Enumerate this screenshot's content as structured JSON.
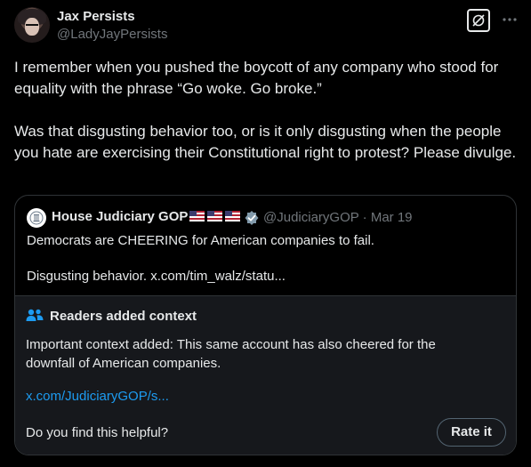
{
  "author": {
    "name": "Jax Persists",
    "handle": "@LadyJayPersists"
  },
  "tweet": {
    "text": "I remember when you pushed the boycott of any company who stood for equality with the phrase “Go woke. Go broke.”\n\nWas that disgusting behavior too, or is it only disgusting when the people you hate are exercising their Constitutional right to protest? Please divulge."
  },
  "quoted": {
    "name": "House Judiciary GOP",
    "handle": "@JudiciaryGOP",
    "separator": "·",
    "date": "Mar 19",
    "text": "Democrats are CHEERING for American companies to fail.\n\nDisgusting behavior. x.com/tim_walz/statu..."
  },
  "context": {
    "title": "Readers added context",
    "body": "Important context added: This same account has also cheered for the downfall of American companies.",
    "link": "x.com/JudiciaryGOP/s...",
    "question": "Do you find this helpful?",
    "rate_label": "Rate it"
  },
  "icons": {
    "grok": "grok-icon",
    "more": "more-icon",
    "verified": "verified-badge-icon",
    "readers": "people-icon",
    "flags": "us-flag-icon"
  },
  "colors": {
    "background": "#000000",
    "text": "#e7e9ea",
    "secondary": "#71767b",
    "link": "#1d9bf0",
    "border": "#2f3336",
    "context_bg": "#16181c"
  }
}
